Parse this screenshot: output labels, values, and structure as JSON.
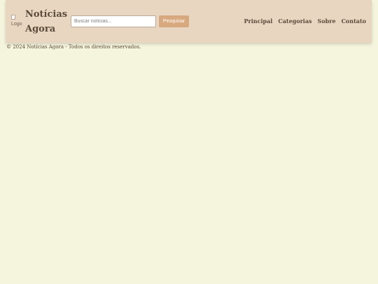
{
  "header": {
    "logo_alt": "Logo",
    "site_title": "Notícias Agora"
  },
  "search": {
    "placeholder": "Buscar notícias...",
    "value": "",
    "button_label": "Pesquisar"
  },
  "nav": {
    "items": [
      {
        "label": "Principal"
      },
      {
        "label": "Categorias"
      },
      {
        "label": "Sobre"
      },
      {
        "label": "Contato"
      }
    ]
  },
  "footer": {
    "copyright": "© 2024 Notícias Agora - Todos os direitos reservados."
  },
  "colors": {
    "background": "#f5f4dc",
    "header": "#e8d6c1",
    "button": "#d8a97e",
    "text": "#5a4a3a"
  }
}
